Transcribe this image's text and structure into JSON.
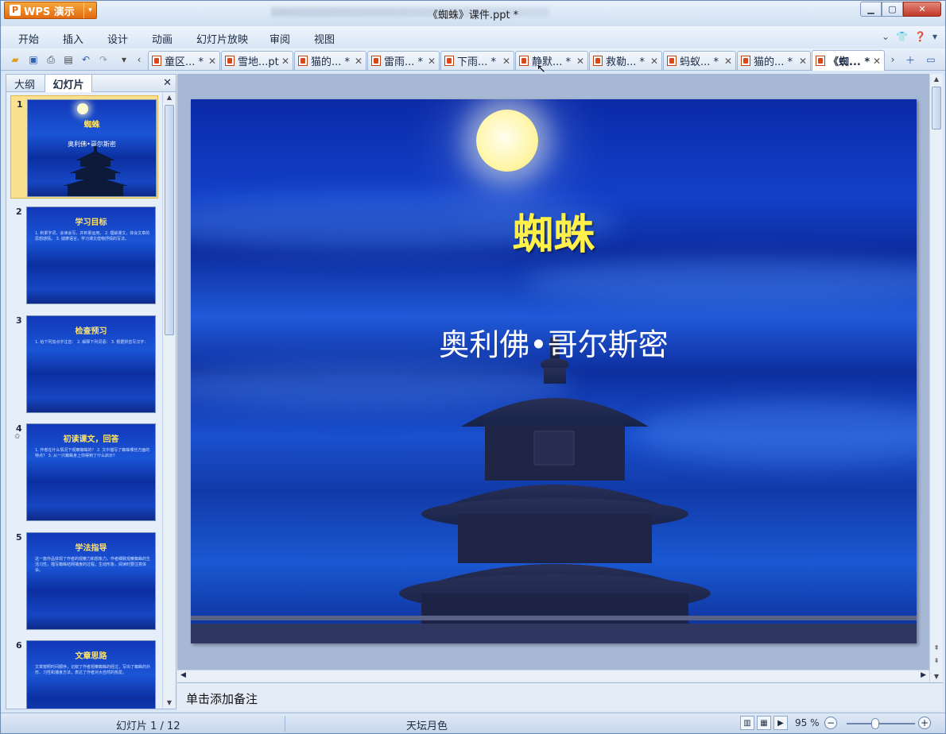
{
  "window": {
    "app_button_label": "WPS 演示",
    "title": "《蜘蛛》课件.ppt *"
  },
  "menu": [
    "开始",
    "插入",
    "设计",
    "动画",
    "幻灯片放映",
    "审阅",
    "视图"
  ],
  "doc_tabs": [
    {
      "label": "童区... *"
    },
    {
      "label": "雪地...pt"
    },
    {
      "label": "猫的... *"
    },
    {
      "label": "雷雨... *"
    },
    {
      "label": "下雨... *"
    },
    {
      "label": "静默... *"
    },
    {
      "label": "救勒... *"
    },
    {
      "label": "蚂蚁... *"
    },
    {
      "label": "猫的... *"
    },
    {
      "label": "《蜘... *",
      "active": true
    }
  ],
  "left_pane": {
    "tabs": [
      "大纲",
      "幻灯片"
    ],
    "thumbnails": [
      {
        "num": "1",
        "title": "蜘蛛",
        "subtitle": "奥利佛•哥尔斯密",
        "body": ""
      },
      {
        "num": "2",
        "title": "学习目标",
        "subtitle": "",
        "body": "1. 积累字词，会读会写，并积累运用。 2. 理解课文，体会文章的思想感情。 3. 揣摩语言，学习课文借物抒情的写法。"
      },
      {
        "num": "3",
        "title": "检查预习",
        "subtitle": "",
        "body": "1. 给下列加点字注音： 2. 解释下列词语： 3. 根据拼音写汉字："
      },
      {
        "num": "4",
        "title": "初读课文，回答",
        "subtitle": "",
        "body": "1. 作者在什么情况下观察蜘蛛的？ 2. 文中描写了蜘蛛哪些方面的特点？ 3. 从一只蜘蛛身上你得到了什么启示？"
      },
      {
        "num": "5",
        "title": "学法指导",
        "subtitle": "",
        "body": "这一篇作品体现了作者的观察力和想象力。作者细致观察蜘蛛的生活习性，描写蜘蛛结网捕食的过程，生动形象，阅读时要注意体会。"
      },
      {
        "num": "6",
        "title": "文章思路",
        "subtitle": "",
        "body": "文章按照时间顺序，记叙了作者观察蜘蛛的经过，写出了蜘蛛的外形、习性和捕食方法，表达了作者对大自然的热爱。"
      }
    ]
  },
  "slide": {
    "title": "蜘蛛",
    "subtitle": "奥利佛•哥尔斯密"
  },
  "notes": {
    "placeholder": "单击添加备注"
  },
  "status": {
    "slide_indicator": "幻灯片 1 / 12",
    "theme": "天坛月色",
    "zoom": "95 %"
  },
  "colors": {
    "title_yellow": "#fff14a",
    "accent_orange": "#e26a10",
    "sel_thumb": "#fbe08e"
  }
}
